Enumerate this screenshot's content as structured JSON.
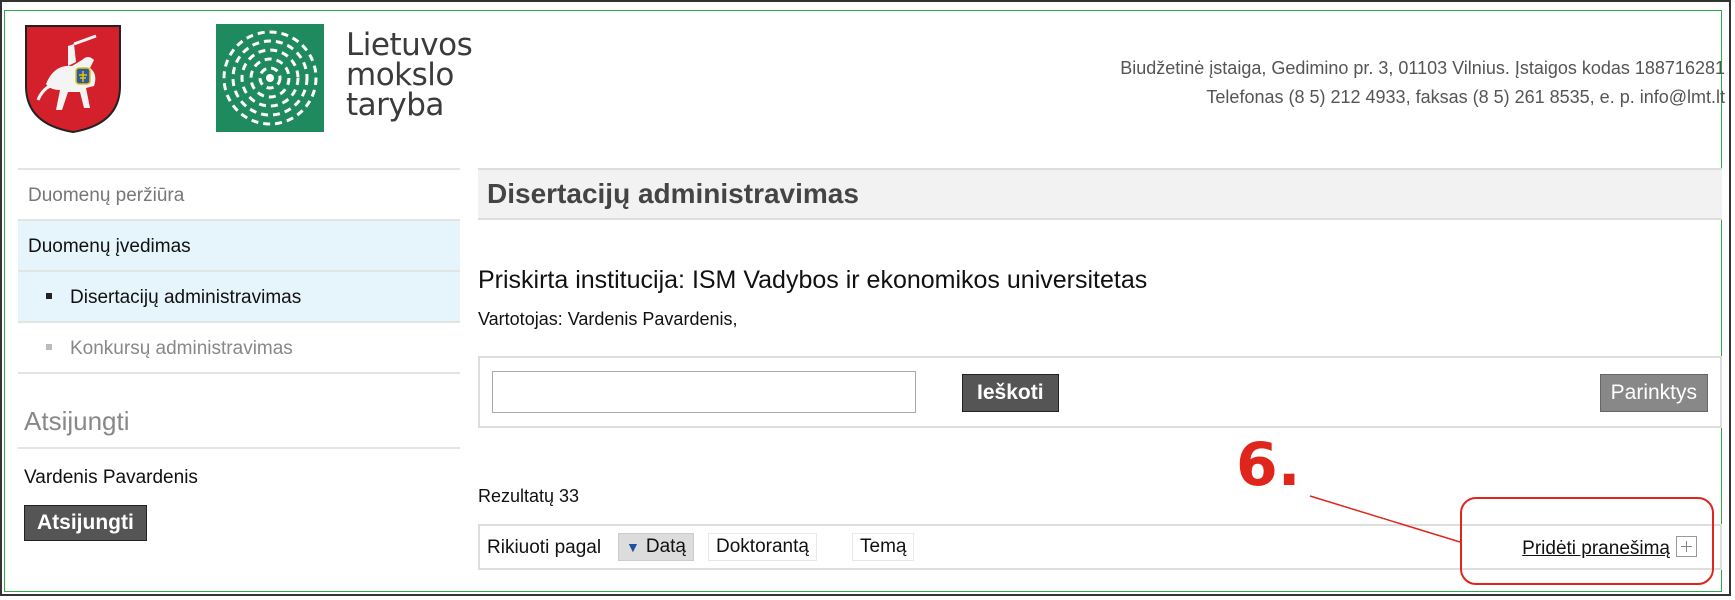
{
  "header": {
    "brand_lines": [
      "Lietuvos",
      "mokslo",
      "taryba"
    ],
    "contact_line1": "Biudžetinė įstaiga, Gedimino pr. 3, 01103 Vilnius. Įstaigos kodas 188716281",
    "contact_line2": "Telefonas (8 5) 212 4933, faksas (8 5) 261 8535, e. p. info@lmt.lt"
  },
  "sidebar": {
    "items": [
      {
        "label": "Duomenų peržiūra"
      },
      {
        "label": "Duomenų įvedimas"
      },
      {
        "label": "Disertacijų administravimas"
      },
      {
        "label": "Konkursų administravimas"
      }
    ],
    "logout_heading": "Atsijungti",
    "user_name": "Vardenis Pavardenis",
    "logout_button": "Atsijungti"
  },
  "main": {
    "title": "Disertacijų administravimas",
    "institution": "Priskirta institucija: ISM Vadybos ir ekonomikos universitetas",
    "user_line": "Vartotojas: Vardenis Pavardenis,",
    "search": {
      "value": "",
      "placeholder": "",
      "button": "Ieškoti",
      "options_button": "Parinktys"
    },
    "results": "Rezultatų 33",
    "sort": {
      "label": "Rikiuoti pagal",
      "options": [
        "Datą",
        "Doktorantą",
        "Temą"
      ],
      "active": "Datą"
    },
    "add_message": "Pridėti pranešimą"
  },
  "annotation": {
    "label": "6.",
    "color": "#e0261c"
  },
  "colors": {
    "accent_green": "#2fa84a",
    "menu_highlight": "#e6f4fb",
    "button_dark": "#555555"
  }
}
